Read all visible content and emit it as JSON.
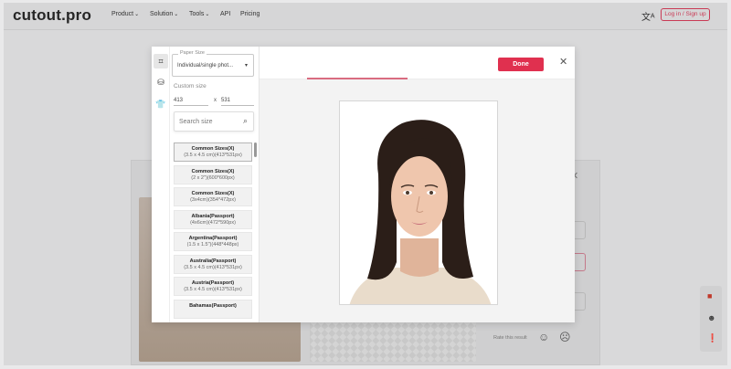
{
  "nav": {
    "logo": "cutout.pro",
    "items": [
      "Product",
      "Solution",
      "Tools",
      "API",
      "Pricing"
    ],
    "login": "Log in / Sign up"
  },
  "background": {
    "rate_text": "Rate this result"
  },
  "modal": {
    "paper_size_label": "Paper Size",
    "paper_size_value": "Individual/single phot...",
    "custom_size_label": "Custom size",
    "width_value": "413",
    "separator": "x",
    "height_value": "531",
    "search_placeholder": "Search size",
    "sizes": [
      {
        "name": "Common Sizes(X)",
        "dim": "(3.5 x 4.5 cm)(413*531px)"
      },
      {
        "name": "Common Sizes(X)",
        "dim": "(2 x 2\")(600*600px)"
      },
      {
        "name": "Common Sizes(X)",
        "dim": "(3x4cm)(354*472px)"
      },
      {
        "name": "Albania(Passport)",
        "dim": "(4x6cm)(472*590px)"
      },
      {
        "name": "Argentina(Passport)",
        "dim": "(1.5 x 1.5\")(448*448px)"
      },
      {
        "name": "Australia(Passport)",
        "dim": "(3.5 x 4.5 cm)(413*531px)"
      },
      {
        "name": "Austria(Passport)",
        "dim": "(3.5 x 4.5 cm)(413*531px)"
      },
      {
        "name": "Bahamas(Passport)",
        "dim": ""
      }
    ],
    "done_label": "Done"
  },
  "colors": {
    "accent": "#e0304f"
  }
}
